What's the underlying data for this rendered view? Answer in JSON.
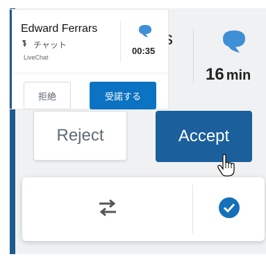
{
  "colors": {
    "accent_bar": "#1d5a8f",
    "accept_large": "#1b5f9c",
    "accept_small": "#0c73c2",
    "chat_icon": "#3e8fd6",
    "check_icon": "#1670b8"
  },
  "notification": {
    "contact_name": "Edward Ferrars",
    "channel_type": "チャット",
    "source": "LiveChat",
    "elapsed": "00:35",
    "reject_label": "拒絶",
    "accept_label": "受諾する",
    "chat_icon": "chat-bubble-icon",
    "type_icon": "arrow-icon"
  },
  "background_card": {
    "name_fragment": "s",
    "wait_value": "16",
    "wait_unit": "min",
    "reject_label": "Reject",
    "accept_label": "Accept",
    "chat_icon": "chat-bubble-icon"
  },
  "action_bar": {
    "transfer_icon": "transfer-arrows-icon",
    "check_icon": "check-circle-icon"
  }
}
